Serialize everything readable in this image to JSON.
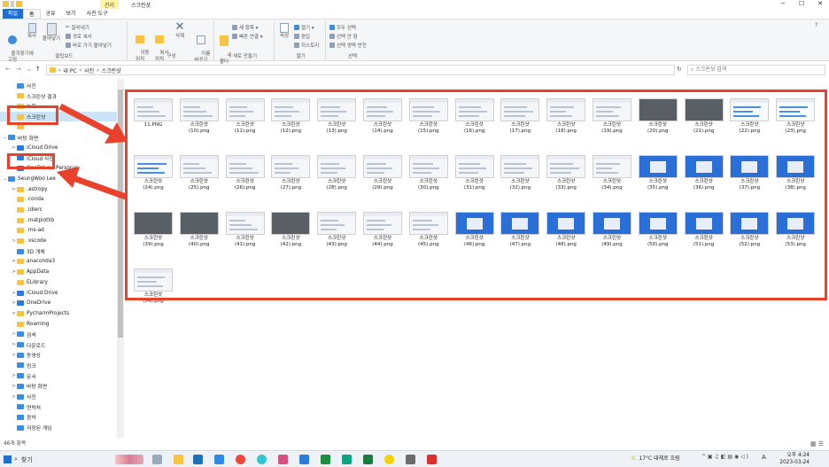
{
  "titlebar": {
    "manage_label": "관리",
    "title": "스크린샷",
    "minimize": "−",
    "maximize": "☐",
    "close": "✕"
  },
  "tabs": [
    "파일",
    "홈",
    "공유",
    "보기",
    "사진 도구"
  ],
  "ribbon": {
    "clipboard": {
      "pin": "즐겨찾기에\n고정",
      "copy": "복사",
      "paste": "붙여넣기",
      "cut": "잘라내기",
      "copy_path": "경로 복사",
      "paste_shortcut": "바로 가기 붙여넣기",
      "group": "클립보드"
    },
    "organize": {
      "move": "이동\n위치",
      "copy_to": "복사\n위치",
      "delete": "삭제",
      "rename": "이름\n바꾸기",
      "group": "구성"
    },
    "new": {
      "new_folder": "새\n폴더",
      "new_item": "새 항목 ▾",
      "easy_access": "빠른 연결 ▾",
      "group": "새로 만들기"
    },
    "open": {
      "properties": "속성",
      "open": "열기 ▾",
      "edit": "편집",
      "history": "히스토리",
      "group": "열기"
    },
    "select": {
      "select_all": "모두 선택",
      "select_none": "선택 안 함",
      "invert": "선택 영역 반전",
      "group": "선택"
    }
  },
  "address": {
    "back": "←",
    "forward": "→",
    "recent": "⌄",
    "up": "↑",
    "path": [
      "내 PC",
      "사진",
      "스크린샷"
    ],
    "refresh": "↻",
    "search_placeholder": "스크린샷 검색"
  },
  "sidebar": {
    "items": [
      {
        "label": "사진",
        "depth": 1,
        "icon": "blue",
        "chev": ""
      },
      {
        "label": "스크린샷 결과",
        "depth": 1,
        "icon": "folder",
        "chev": ""
      },
      {
        "label": "녹화",
        "depth": 1,
        "icon": "folder",
        "chev": ""
      },
      {
        "label": "스크린샷",
        "depth": 1,
        "icon": "folder",
        "chev": "",
        "selected": true
      },
      {
        "label": "",
        "depth": 1,
        "icon": "folder",
        "chev": ""
      },
      {
        "label": "바탕 화면",
        "depth": 0,
        "icon": "blue",
        "chev": "⌄"
      },
      {
        "label": "iCloud Drive",
        "depth": 1,
        "icon": "cloud",
        "chev": ">"
      },
      {
        "label": "iCloud 사진",
        "depth": 1,
        "icon": "cloud",
        "chev": ""
      },
      {
        "label": "OneDrive - Personal",
        "depth": 1,
        "icon": "cloud",
        "chev": ">"
      },
      {
        "label": "SeungWoo Lee",
        "depth": 0,
        "icon": "blue",
        "chev": "⌄"
      },
      {
        "label": ".astropy",
        "depth": 1,
        "icon": "folder",
        "chev": ">"
      },
      {
        "label": ".conda",
        "depth": 1,
        "icon": "folder",
        "chev": ""
      },
      {
        "label": ".idlerc",
        "depth": 1,
        "icon": "folder",
        "chev": ""
      },
      {
        "label": ".matplotlib",
        "depth": 1,
        "icon": "folder",
        "chev": ""
      },
      {
        "label": ".ms-ad",
        "depth": 1,
        "icon": "folder",
        "chev": ""
      },
      {
        "label": ".vscode",
        "depth": 1,
        "icon": "folder",
        "chev": ">"
      },
      {
        "label": "3D 개체",
        "depth": 1,
        "icon": "blue",
        "chev": ""
      },
      {
        "label": "anaconda3",
        "depth": 1,
        "icon": "folder",
        "chev": ">"
      },
      {
        "label": "AppData",
        "depth": 1,
        "icon": "folder",
        "chev": ">"
      },
      {
        "label": "ELibrary",
        "depth": 1,
        "icon": "folder",
        "chev": ""
      },
      {
        "label": "iCloud Drive",
        "depth": 1,
        "icon": "cloud",
        "chev": ">"
      },
      {
        "label": "OneDrive",
        "depth": 1,
        "icon": "cloud",
        "chev": ">"
      },
      {
        "label": "PycharmProjects",
        "depth": 1,
        "icon": "folder",
        "chev": ">"
      },
      {
        "label": "Roaming",
        "depth": 1,
        "icon": "folder",
        "chev": ""
      },
      {
        "label": "검색",
        "depth": 1,
        "icon": "blue",
        "chev": ">"
      },
      {
        "label": "다운로드",
        "depth": 1,
        "icon": "blue",
        "chev": ">"
      },
      {
        "label": "동영상",
        "depth": 1,
        "icon": "blue",
        "chev": ">"
      },
      {
        "label": "링크",
        "depth": 1,
        "icon": "blue",
        "chev": ""
      },
      {
        "label": "문서",
        "depth": 1,
        "icon": "blue",
        "chev": ">"
      },
      {
        "label": "바탕 화면",
        "depth": 1,
        "icon": "blue",
        "chev": ">"
      },
      {
        "label": "사진",
        "depth": 1,
        "icon": "blue",
        "chev": ">"
      },
      {
        "label": "연락처",
        "depth": 1,
        "icon": "blue",
        "chev": ""
      },
      {
        "label": "음악",
        "depth": 1,
        "icon": "blue",
        "chev": ""
      },
      {
        "label": "저장된 게임",
        "depth": 1,
        "icon": "blue",
        "chev": ""
      }
    ]
  },
  "files": [
    {
      "name": "11.PNG",
      "style": "ui"
    },
    {
      "name": "스크린샷\n(10).png",
      "style": "ui"
    },
    {
      "name": "스크린샷\n(11).png",
      "style": "ui"
    },
    {
      "name": "스크린샷\n(12).png",
      "style": "ui"
    },
    {
      "name": "스크린샷\n(13).png",
      "style": "ui"
    },
    {
      "name": "스크린샷\n(14).png",
      "style": "ui"
    },
    {
      "name": "스크린샷\n(15).png",
      "style": "ui"
    },
    {
      "name": "스크린샷\n(16).png",
      "style": "ui"
    },
    {
      "name": "스크린샷\n(17).png",
      "style": "ui"
    },
    {
      "name": "스크린샷\n(18).png",
      "style": "ui"
    },
    {
      "name": "스크린샷\n(19).png",
      "style": "ui"
    },
    {
      "name": "스크린샷\n(20).png",
      "style": "dark"
    },
    {
      "name": "스크린샷\n(21).png",
      "style": "dark"
    },
    {
      "name": "스크린샷\n(22).png",
      "style": "chart"
    },
    {
      "name": "스크린샷\n(23).png",
      "style": "chart"
    },
    {
      "name": "스크린샷\n(24).png",
      "style": "chart"
    },
    {
      "name": "스크린샷\n(25).png",
      "style": "ui"
    },
    {
      "name": "스크린샷\n(26).png",
      "style": "ui"
    },
    {
      "name": "스크린샷\n(27).png",
      "style": "ui"
    },
    {
      "name": "스크린샷\n(28).png",
      "style": "ui"
    },
    {
      "name": "스크린샷\n(29).png",
      "style": "ui"
    },
    {
      "name": "스크린샷\n(30).png",
      "style": "ui"
    },
    {
      "name": "스크린샷\n(31).png",
      "style": "ui"
    },
    {
      "name": "스크린샷\n(32).png",
      "style": "ui"
    },
    {
      "name": "스크린샷\n(33).png",
      "style": "ui"
    },
    {
      "name": "스크린샷\n(34).png",
      "style": "ui"
    },
    {
      "name": "스크린샷\n(35).png",
      "style": "blue"
    },
    {
      "name": "스크린샷\n(36).png",
      "style": "blue"
    },
    {
      "name": "스크린샷\n(37).png",
      "style": "blue"
    },
    {
      "name": "스크린샷\n(38).png",
      "style": "blue"
    },
    {
      "name": "스크린샷\n(39).png",
      "style": "dark"
    },
    {
      "name": "스크린샷\n(40).png",
      "style": "dark"
    },
    {
      "name": "스크린샷\n(41).png",
      "style": "ui"
    },
    {
      "name": "스크린샷\n(42).png",
      "style": "dark"
    },
    {
      "name": "스크린샷\n(43).png",
      "style": "ui"
    },
    {
      "name": "스크린샷\n(44).png",
      "style": "ui"
    },
    {
      "name": "스크린샷\n(45).png",
      "style": "ui"
    },
    {
      "name": "스크린샷\n(46).png",
      "style": "blue"
    },
    {
      "name": "스크린샷\n(47).png",
      "style": "blue"
    },
    {
      "name": "스크린샷\n(48).png",
      "style": "blue"
    },
    {
      "name": "스크린샷\n(49).png",
      "style": "blue"
    },
    {
      "name": "스크린샷\n(50).png",
      "style": "blue"
    },
    {
      "name": "스크린샷\n(51).png",
      "style": "blue"
    },
    {
      "name": "스크린샷\n(52).png",
      "style": "blue"
    },
    {
      "name": "스크린샷\n(53).png",
      "style": "blue"
    },
    {
      "name": "스크린샷\n(54).png",
      "style": "ui"
    }
  ],
  "status": {
    "count": "46개 항목"
  },
  "taskbar": {
    "search_label": "찾기",
    "weather": "17°C 대체로 흐림",
    "time": "오후 4:24",
    "date": "2023-03-24",
    "lang": "A"
  },
  "colors": {
    "annotation_red": "#e8412c",
    "selection_blue": "#cce4f7",
    "file_tab": "#1e6fd1"
  }
}
